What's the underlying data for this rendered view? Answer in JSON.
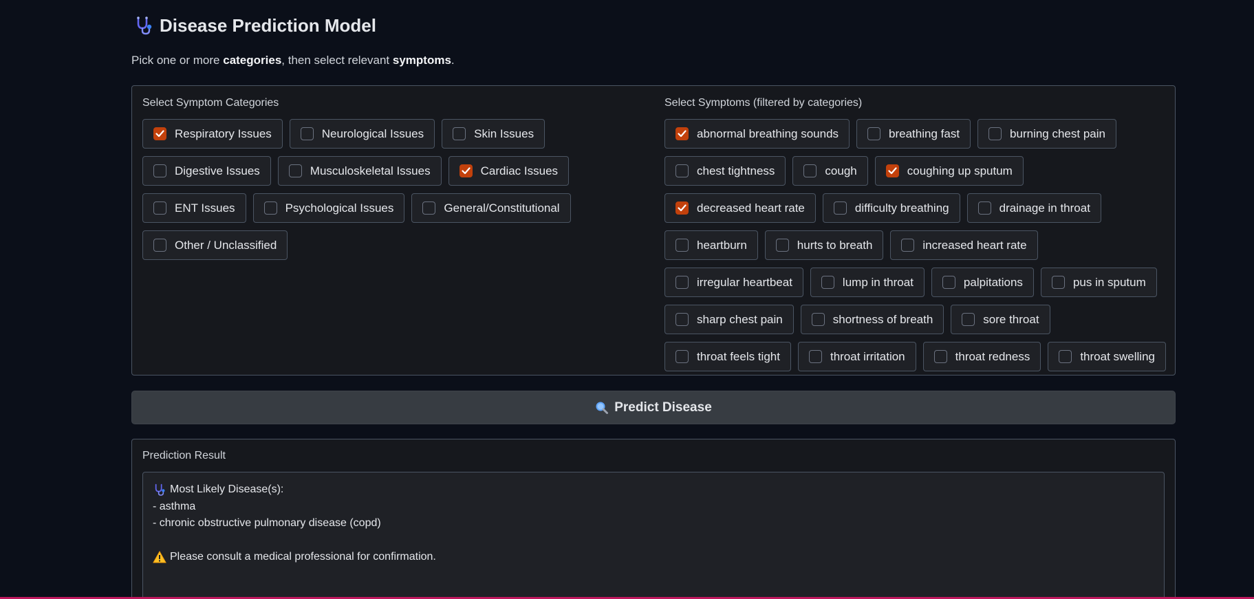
{
  "header": {
    "title": "Disease Prediction Model",
    "subtitle_prefix": "Pick one or more ",
    "subtitle_bold1": "categories",
    "subtitle_mid": ", then select relevant ",
    "subtitle_bold2": "symptoms",
    "subtitle_suffix": "."
  },
  "categories": {
    "label": "Select Symptom Categories",
    "items": [
      {
        "label": "Respiratory Issues",
        "checked": true
      },
      {
        "label": "Neurological Issues",
        "checked": false
      },
      {
        "label": "Skin Issues",
        "checked": false
      },
      {
        "label": "Digestive Issues",
        "checked": false
      },
      {
        "label": "Musculoskeletal Issues",
        "checked": false
      },
      {
        "label": "Cardiac Issues",
        "checked": true
      },
      {
        "label": "ENT Issues",
        "checked": false
      },
      {
        "label": "Psychological Issues",
        "checked": false
      },
      {
        "label": "General/Constitutional",
        "checked": false
      },
      {
        "label": "Other / Unclassified",
        "checked": false
      }
    ]
  },
  "symptoms": {
    "label": "Select Symptoms (filtered by categories)",
    "items": [
      {
        "label": "abnormal breathing sounds",
        "checked": true
      },
      {
        "label": "breathing fast",
        "checked": false
      },
      {
        "label": "burning chest pain",
        "checked": false
      },
      {
        "label": "chest tightness",
        "checked": false
      },
      {
        "label": "cough",
        "checked": false
      },
      {
        "label": "coughing up sputum",
        "checked": true
      },
      {
        "label": "decreased heart rate",
        "checked": true
      },
      {
        "label": "difficulty breathing",
        "checked": false
      },
      {
        "label": "drainage in throat",
        "checked": false
      },
      {
        "label": "heartburn",
        "checked": false
      },
      {
        "label": "hurts to breath",
        "checked": false
      },
      {
        "label": "increased heart rate",
        "checked": false
      },
      {
        "label": "irregular heartbeat",
        "checked": false
      },
      {
        "label": "lump in throat",
        "checked": false
      },
      {
        "label": "palpitations",
        "checked": false
      },
      {
        "label": "pus in sputum",
        "checked": false
      },
      {
        "label": "sharp chest pain",
        "checked": false
      },
      {
        "label": "shortness of breath",
        "checked": false
      },
      {
        "label": "sore throat",
        "checked": false
      },
      {
        "label": "throat feels tight",
        "checked": false
      },
      {
        "label": "throat irritation",
        "checked": false
      },
      {
        "label": "throat redness",
        "checked": false
      },
      {
        "label": "throat swelling",
        "checked": false
      }
    ]
  },
  "predict_button": {
    "label": "Predict Disease",
    "icon": "magnifier-icon"
  },
  "result": {
    "label": "Prediction Result",
    "heading": "Most Likely Disease(s):",
    "diseases": [
      "- asthma",
      "- chronic obstructive pulmonary disease (copd)"
    ],
    "warning": "Please consult a medical professional for confirmation."
  },
  "colors": {
    "background": "#0b0f19",
    "checked": "#c2410c",
    "accent_bar": "#be185d"
  }
}
